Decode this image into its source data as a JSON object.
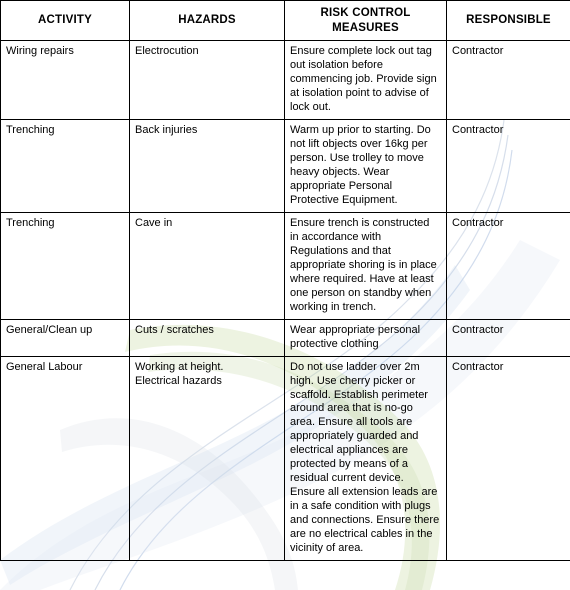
{
  "table": {
    "columns": [
      "ACTIVITY",
      "HAZARDS",
      "RISK CONTROL MEASURES",
      "RESPONSIBLE"
    ],
    "rows": [
      {
        "activity": "Wiring repairs",
        "hazards": "Electrocution",
        "measures": "Ensure complete lock out tag out isolation before commencing job. Provide sign at isolation point to advise of lock out.",
        "responsible": "Contractor"
      },
      {
        "activity": "Trenching",
        "hazards": "Back injuries",
        "measures": "Warm up prior to starting. Do not lift objects over 16kg per person. Use trolley to move heavy objects. Wear appropriate Personal Protective Equipment.",
        "responsible": "Contractor"
      },
      {
        "activity": "Trenching",
        "hazards": "Cave in",
        "measures": "Ensure trench is constructed in accordance with Regulations and that appropriate shoring is in place where required. Have at least one person on standby when working in trench.",
        "responsible": "Contractor"
      },
      {
        "activity": "General/Clean up",
        "hazards": "Cuts / scratches",
        "measures": "Wear appropriate personal protective clothing",
        "responsible": "Contractor"
      },
      {
        "activity": "General Labour",
        "hazards": "Working at height.\nElectrical hazards",
        "measures": "Do not use ladder over 2m high. Use cherry picker or scaffold. Establish perimeter around area that is no-go area. Ensure all tools are appropriately guarded and electrical appliances are protected by means of a residual current device. Ensure all extension leads are in a safe condition with plugs and connections. Ensure there are no electrical cables in the vicinity of area.",
        "responsible": "Contractor"
      }
    ]
  },
  "colors": {
    "border": "#000000",
    "text": "#000000",
    "art_green": "#b9d08b",
    "art_blue": "#b8c6e0",
    "art_grey": "#d8dbe2"
  }
}
